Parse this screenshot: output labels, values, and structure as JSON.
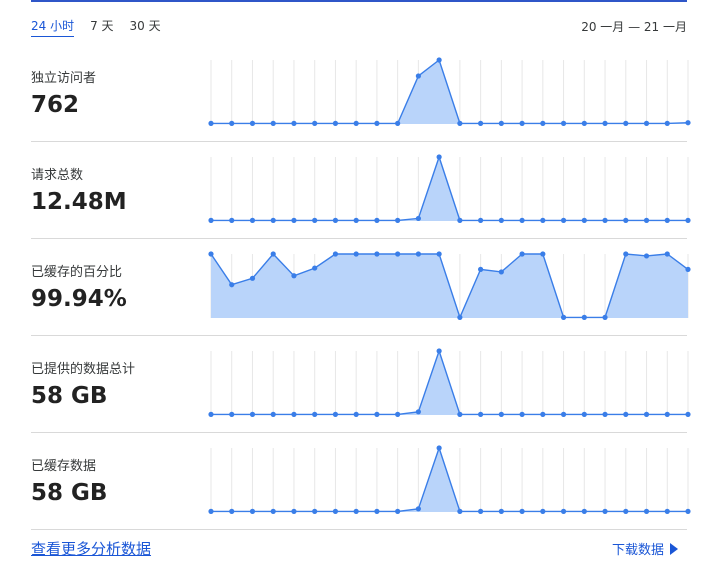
{
  "tabs": [
    "24 小时",
    "7 天",
    "30 天"
  ],
  "date_range": "20 一月 — 21 一月",
  "bottom_link": "查看更多分析数据",
  "download_label": "下载数据",
  "icons": {
    "download_arrow": "play-triangle-icon"
  },
  "colors": {
    "accent": "#1a56d6",
    "line": "#3a7ee8",
    "fill": "#b9d4fa"
  },
  "metrics": [
    {
      "label": "独立访问者",
      "value": "762"
    },
    {
      "label": "请求总数",
      "value": "12.48M"
    },
    {
      "label": "已缓存的百分比",
      "value": "99.94%"
    },
    {
      "label": "已提供的数据总计",
      "value": "58 GB"
    },
    {
      "label": "已缓存数据",
      "value": "58 GB"
    }
  ],
  "chart_data": [
    {
      "type": "area",
      "title": "独立访问者",
      "ylim": [
        0,
        100
      ],
      "values": [
        1,
        1,
        1,
        1,
        1,
        1,
        1,
        1,
        1,
        1,
        75,
        100,
        1,
        1,
        1,
        1,
        1,
        1,
        1,
        1,
        1,
        1,
        1,
        2
      ]
    },
    {
      "type": "area",
      "title": "请求总数",
      "ylim": [
        0,
        100
      ],
      "values": [
        1,
        1,
        1,
        1,
        1,
        1,
        1,
        1,
        1,
        1,
        4,
        100,
        1,
        1,
        1,
        1,
        1,
        1,
        1,
        1,
        1,
        1,
        1,
        1
      ]
    },
    {
      "type": "area",
      "title": "已缓存的百分比",
      "ylim": [
        0,
        100
      ],
      "values": [
        100,
        52,
        62,
        100,
        66,
        78,
        100,
        100,
        100,
        100,
        100,
        100,
        1,
        76,
        72,
        100,
        100,
        1,
        1,
        1,
        100,
        97,
        100,
        76
      ]
    },
    {
      "type": "area",
      "title": "已提供的数据总计",
      "ylim": [
        0,
        100
      ],
      "values": [
        1,
        1,
        1,
        1,
        1,
        1,
        1,
        1,
        1,
        1,
        5,
        100,
        1,
        1,
        1,
        1,
        1,
        1,
        1,
        1,
        1,
        1,
        1,
        1
      ]
    },
    {
      "type": "area",
      "title": "已缓存数据",
      "ylim": [
        0,
        100
      ],
      "values": [
        1,
        1,
        1,
        1,
        1,
        1,
        1,
        1,
        1,
        1,
        5,
        100,
        1,
        1,
        1,
        1,
        1,
        1,
        1,
        1,
        1,
        1,
        1,
        1
      ]
    }
  ]
}
